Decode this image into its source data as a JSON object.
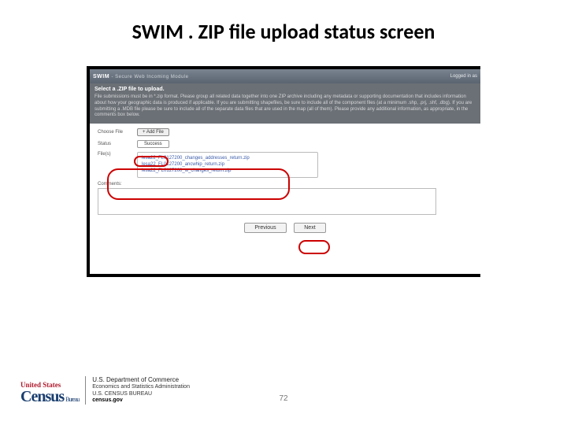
{
  "slide": {
    "title": "SWIM . ZIP file upload status screen",
    "page_number": "72"
  },
  "swim": {
    "app_name": "SWIM",
    "app_tagline": "- Secure Web Incoming Module",
    "logged_in": "Logged in as",
    "section_title": "Select a .ZIP file to upload.",
    "section_body": "File submissions must be in *.zip format. Please group all related data together into one ZIP archive including any metadata or supporting documentation that includes information about how your geographic data is produced if applicable. If you are submitting shapefiles, be sure to include all of the component files (at a minimum .shp, .prj, .shf, .dbg). If you are submitting a .MDB file please be sure to include all of the separate data files that are used in the map (all of them). Please provide any additional information, as appropriate, in the comments box below.",
    "choose_file_label": "Choose File",
    "add_file_button": "+ Add File",
    "status_label": "Status",
    "status_value": "Success",
    "files_label": "File(s)",
    "files": [
      "lesa22_FL0127200_changes_addresses_return.zip",
      "lesa22_FL0127200_ancwhip_return.zip",
      "lesa22_FL0127200_w_changes_return.zip"
    ],
    "comments_label": "Comments:",
    "prev_button": "Previous",
    "next_button": "Next"
  },
  "footer": {
    "census_top": "United States",
    "census_main": "Census",
    "census_bureau": "Bureau",
    "dept1": "U.S. Department of Commerce",
    "dept2": "Economics and Statistics Administration",
    "dept3": "U.S. CENSUS BUREAU",
    "dept4": "census.gov"
  }
}
